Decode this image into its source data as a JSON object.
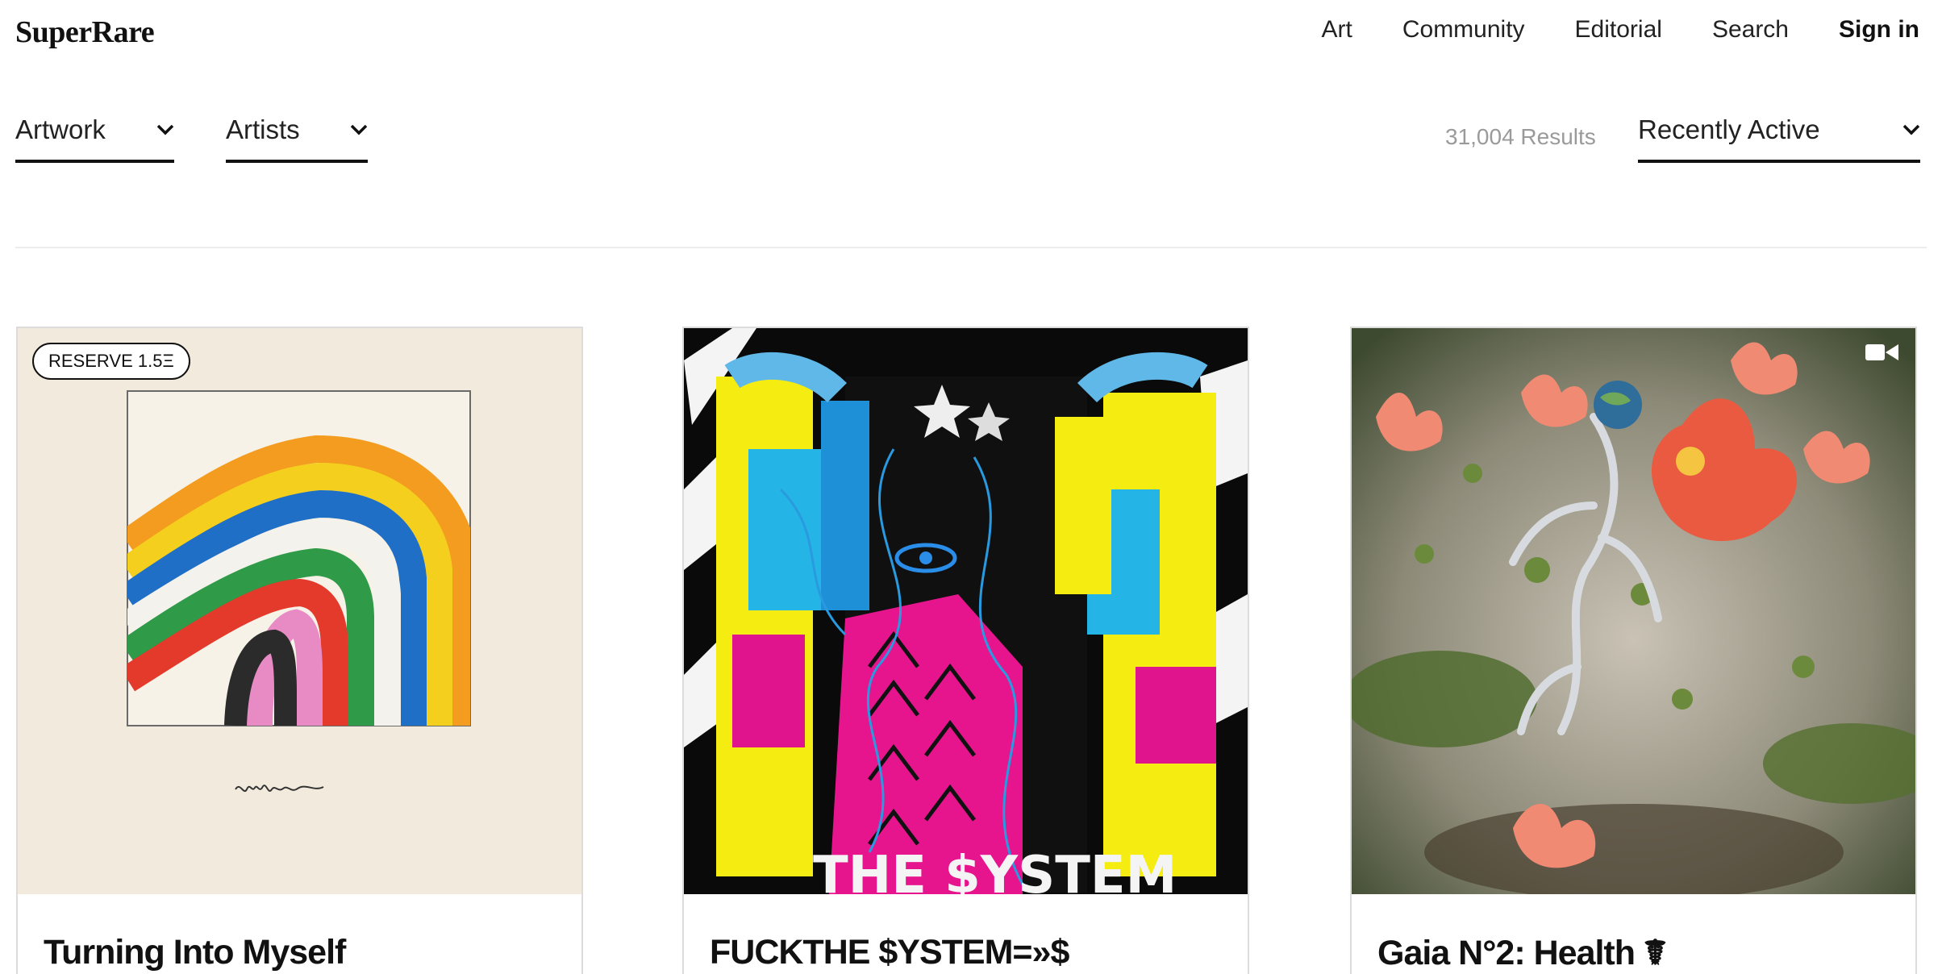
{
  "header": {
    "logo": "SuperRare",
    "nav": [
      "Art",
      "Community",
      "Editorial",
      "Search"
    ],
    "sign_in": "Sign in"
  },
  "filters": {
    "artwork": "Artwork",
    "artists": "Artists",
    "results": "31,004 Results",
    "sort": "Recently Active"
  },
  "cards": [
    {
      "title": "Turning Into Myself",
      "badge": "RESERVE 1.5Ξ",
      "signature": "vittoria"
    },
    {
      "title": "FUCKTHE $YSTEM=»$",
      "overlay_text": "THE $YSTEM"
    },
    {
      "title": "Gaia N°2: Health ☤",
      "media": "video-icon"
    }
  ],
  "colors": {
    "text": "#111111",
    "muted": "#9a9a9a",
    "divider": "#ececec",
    "card_border": "#dcdcdc",
    "paper": "#f2ebdd"
  }
}
